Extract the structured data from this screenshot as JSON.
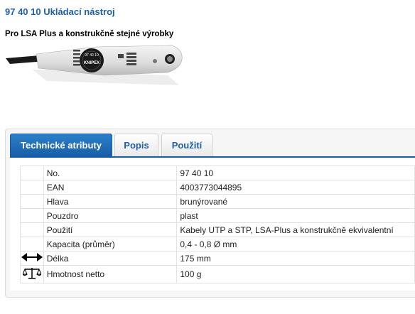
{
  "header": {
    "title": "97 40 10 Ukládací nástroj",
    "subtitle": "Pro LSA Plus a konstrukčně stejné výrobky"
  },
  "product_image": {
    "brand_text": "KNIPEX",
    "code_text": "97 40 10"
  },
  "tabs": [
    {
      "label": "Technické atributy",
      "active": true
    },
    {
      "label": "Popis",
      "active": false
    },
    {
      "label": "Použití",
      "active": false
    }
  ],
  "attributes": [
    {
      "label": "No.",
      "value": "97 40 10",
      "icon": ""
    },
    {
      "label": "EAN",
      "value": "4003773044895",
      "icon": ""
    },
    {
      "label": "Hlava",
      "value": "brunýrované",
      "icon": ""
    },
    {
      "label": "Pouzdro",
      "value": "plast",
      "icon": ""
    },
    {
      "label": "Použití",
      "value": "Kabely UTP a STP, LSA-Plus a konstrukčně ekvivalentní",
      "icon": ""
    },
    {
      "label": "Kapacita (průměr)",
      "value": "0,4 - 0,8 Ø mm",
      "icon": ""
    },
    {
      "label": "Délka",
      "value": "175 mm",
      "icon": "length-arrow-icon"
    },
    {
      "label": "Hmotnost netto",
      "value": "100 g",
      "icon": "scale-icon"
    }
  ],
  "colors": {
    "title": "#1f5fa8",
    "tab_active": "#175ea8"
  }
}
